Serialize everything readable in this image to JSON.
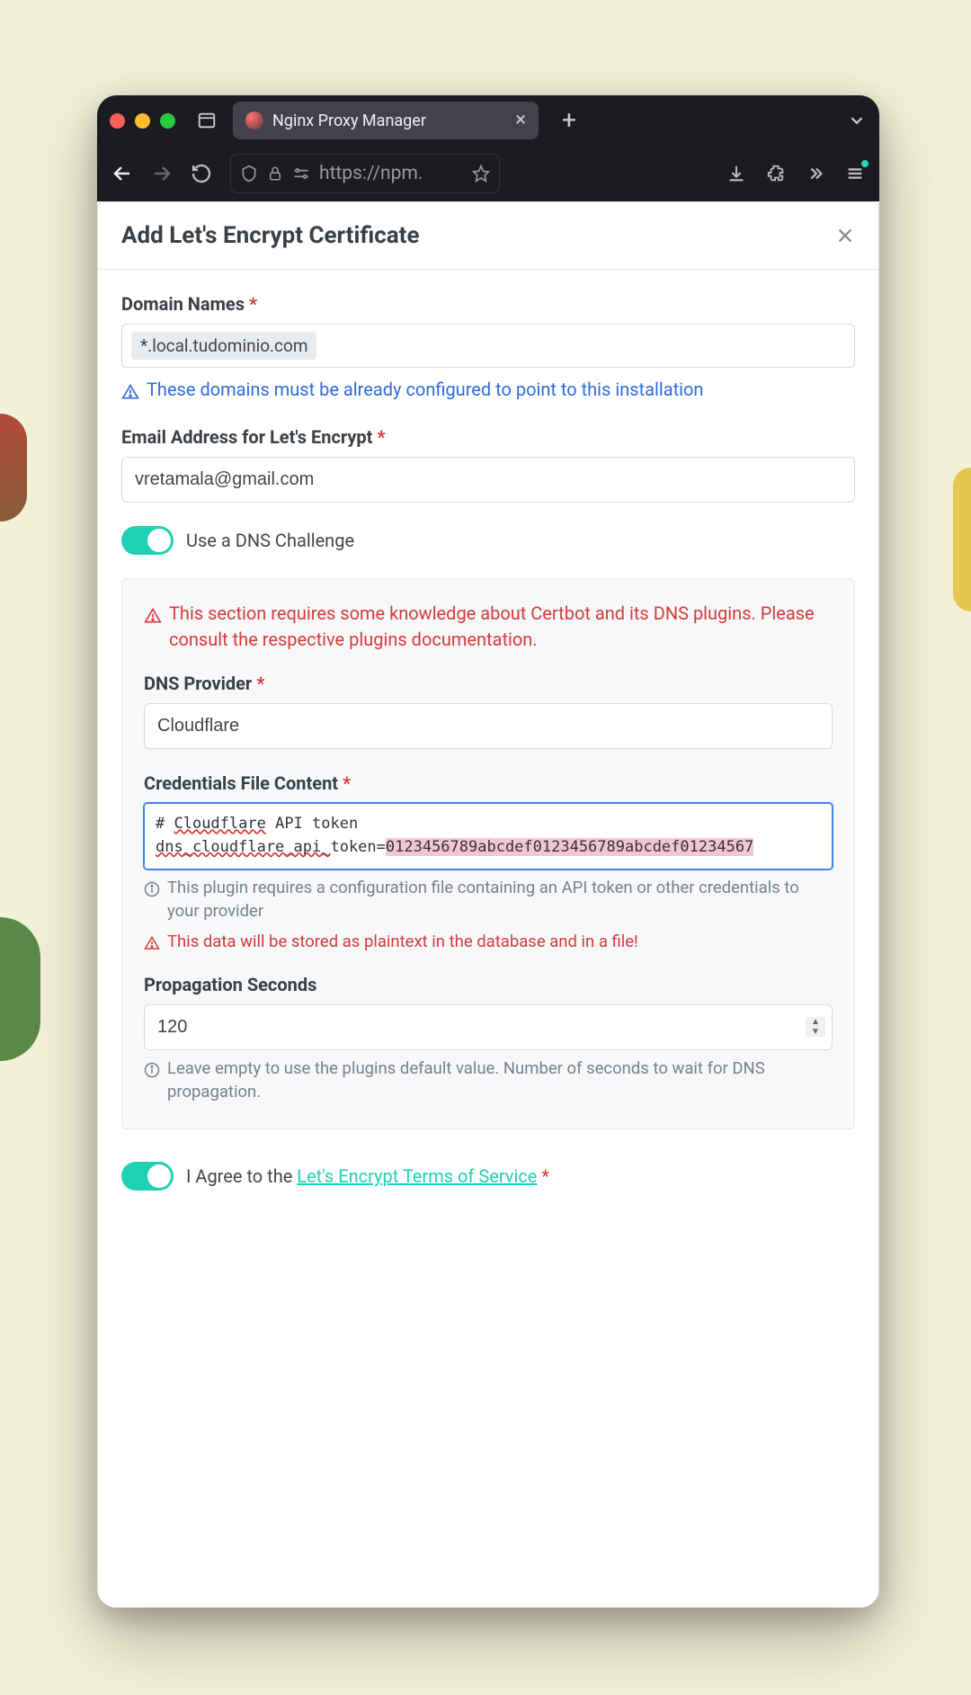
{
  "browser": {
    "tab_title": "Nginx Proxy Manager",
    "url_display": "https://npm."
  },
  "modal": {
    "title": "Add Let's Encrypt Certificate",
    "domain_names_label": "Domain Names",
    "domain_chip": "*.local.tudominio.com",
    "domain_hint": "These domains must be already configured to point to this installation",
    "email_label": "Email Address for Let's Encrypt",
    "email_value": "vretamala@gmail.com",
    "dns_toggle_label": "Use a DNS Challenge",
    "dns_warn": "This section requires some knowledge about Certbot and its DNS plugins. Please consult the respective plugins documentation.",
    "provider_label": "DNS Provider",
    "provider_value": "Cloudflare",
    "creds_label": "Credentials File Content",
    "creds_line1_a": "# ",
    "creds_line1_b": "Cloudflare",
    "creds_line1_c": " API token",
    "creds_line2_a": "dns_cloudflare_api_",
    "creds_line2_b": "token=",
    "creds_line2_c": "0123456789abcdef0123456789abcdef01234567",
    "creds_hint": "This plugin requires a configuration file containing an API token or other credentials to your provider",
    "creds_warn": "This data will be stored as plaintext in the database and in a file!",
    "propagation_label": "Propagation Seconds",
    "propagation_value": "120",
    "propagation_hint": "Leave empty to use the plugins default value. Number of seconds to wait for DNS propagation.",
    "agree_prefix": "I Agree to the ",
    "agree_link": "Let's Encrypt Terms of Service"
  }
}
